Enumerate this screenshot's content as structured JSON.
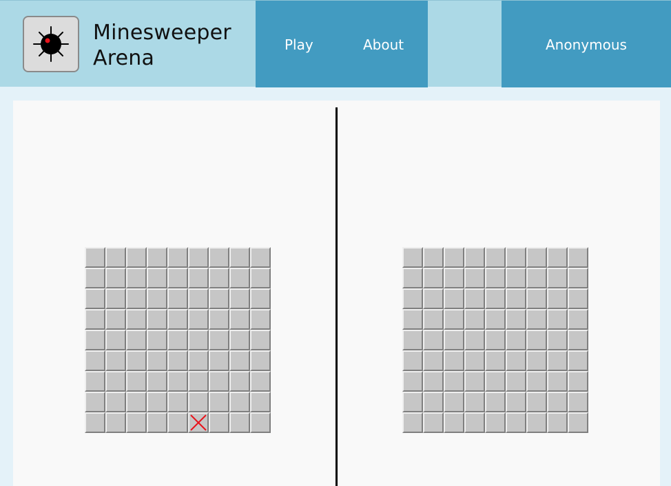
{
  "header": {
    "logo_icon": "mine-icon",
    "title_line1": "Minesweeper",
    "title_line2": "Arena",
    "nav": {
      "play": "Play",
      "about": "About",
      "user": "Anonymous"
    }
  },
  "boards": [
    {
      "id": "left",
      "rows": 9,
      "cols": 9,
      "marked_cells": [
        {
          "row": 8,
          "col": 5,
          "icon": "cross-mark-icon",
          "color": "#e8141c"
        }
      ]
    },
    {
      "id": "right",
      "rows": 9,
      "cols": 9,
      "marked_cells": []
    }
  ],
  "colors": {
    "header_bg": "#acd9e6",
    "nav_bg": "#429bc1",
    "page_bg": "#e4f2f9",
    "content_bg": "#f9f9f9",
    "cell_bg": "#c6c6c6"
  }
}
